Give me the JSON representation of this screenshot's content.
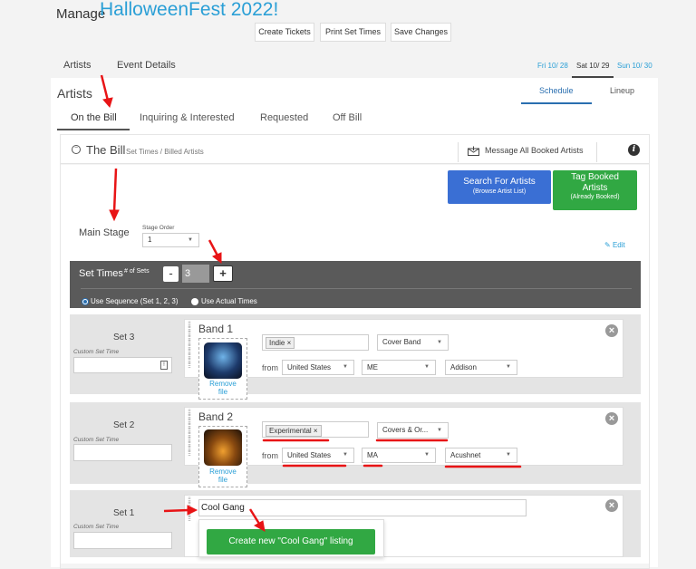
{
  "header": {
    "manage_label": "Manage",
    "event_name": "HalloweenFest 2022!",
    "buttons": [
      "Create Tickets",
      "Print Set Times",
      "Save Changes"
    ]
  },
  "main_tabs": [
    "Artists",
    "Event Details"
  ],
  "dates": [
    "Fri 10/ 28",
    "Sat 10/ 29",
    "Sun 10/ 30"
  ],
  "artists_title": "Artists",
  "view_tabs": [
    "Schedule",
    "Lineup"
  ],
  "sub_tabs": [
    "On the Bill",
    "Inquiring & Interested",
    "Requested",
    "Off Bill"
  ],
  "bill": {
    "title": "The Bill",
    "subtitle": "Set Times / Billed Artists",
    "message_all": "Message All Booked Artists",
    "info": "i"
  },
  "search_button": {
    "line1": "Search For Artists",
    "line2": "(Browse Artist List)"
  },
  "tag_button": {
    "line1": "Tag Booked",
    "line2": "Artists",
    "line3": "(Already Booked)"
  },
  "stage": {
    "name": "Main Stage",
    "order_label": "Stage Order",
    "order_value": "1",
    "edit": "Edit"
  },
  "set_times": {
    "title": "Set Times",
    "num_label": "# of Sets",
    "minus": "-",
    "count": "3",
    "plus": "+",
    "radio_sequence": "Use Sequence (Set 1, 2, 3)",
    "radio_actual": "Use Actual Times",
    "sequence_selected": true
  },
  "sets": [
    {
      "set_label": "Set 3",
      "custom_label": "Custom Set Time",
      "band_name": "Band 1",
      "genre_tag": "Indie",
      "tag_x": "×",
      "type": "Cover Band",
      "from": "from",
      "country": "United States",
      "state": "ME",
      "city": "Addison",
      "remove_file": [
        "Remove",
        "file"
      ]
    },
    {
      "set_label": "Set 2",
      "custom_label": "Custom Set Time",
      "band_name": "Band 2",
      "genre_tag": "Experimental",
      "tag_x": "×",
      "type": "Covers & Or...",
      "from": "from",
      "country": "United States",
      "state": "MA",
      "city": "Acushnet",
      "remove_file": [
        "Remove",
        "file"
      ]
    },
    {
      "set_label": "Set 1",
      "custom_label": "Custom Set Time",
      "band_input_value": "Cool Gang"
    }
  ],
  "create_listing": "Create new \"Cool Gang\" listing",
  "colors": {
    "accent": "#2a9fd6",
    "search_blue": "#3a6fd4",
    "tag_green": "#31a843",
    "annotation_red": "#e81416"
  }
}
